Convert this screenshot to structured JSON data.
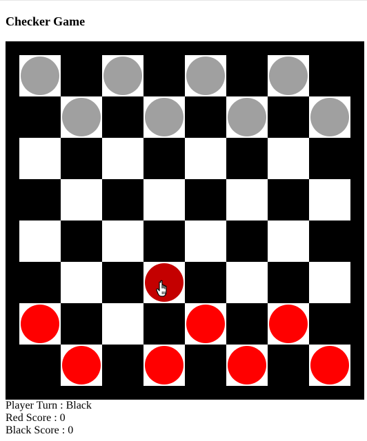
{
  "page": {
    "title": "Checker Game"
  },
  "status": {
    "turn_label": "Player Turn : ",
    "turn_value": "Black",
    "red_label": "Red Score : ",
    "red_value": "0",
    "black_label": "Black Score : ",
    "black_value": "0"
  },
  "board": {
    "rows": 8,
    "cols": 8,
    "square_colors": {
      "light": "#ffffff",
      "dark": "#000000"
    },
    "piece_colors": {
      "black": "#a0a0a0",
      "red": "#ff0000",
      "selected": "#c40000"
    },
    "pieces": [
      {
        "row": 0,
        "col": 0,
        "side": "black"
      },
      {
        "row": 0,
        "col": 2,
        "side": "black"
      },
      {
        "row": 0,
        "col": 4,
        "side": "black"
      },
      {
        "row": 0,
        "col": 6,
        "side": "black"
      },
      {
        "row": 1,
        "col": 1,
        "side": "black"
      },
      {
        "row": 1,
        "col": 3,
        "side": "black"
      },
      {
        "row": 1,
        "col": 5,
        "side": "black"
      },
      {
        "row": 1,
        "col": 7,
        "side": "black"
      },
      {
        "row": 5,
        "col": 3,
        "side": "red",
        "selected": true
      },
      {
        "row": 6,
        "col": 0,
        "side": "red"
      },
      {
        "row": 6,
        "col": 4,
        "side": "red"
      },
      {
        "row": 6,
        "col": 6,
        "side": "red"
      },
      {
        "row": 7,
        "col": 1,
        "side": "red"
      },
      {
        "row": 7,
        "col": 3,
        "side": "red"
      },
      {
        "row": 7,
        "col": 5,
        "side": "red"
      },
      {
        "row": 7,
        "col": 7,
        "side": "red"
      }
    ],
    "cursor": {
      "row": 5,
      "col": 3,
      "icon": "hand-pointer-icon"
    }
  }
}
